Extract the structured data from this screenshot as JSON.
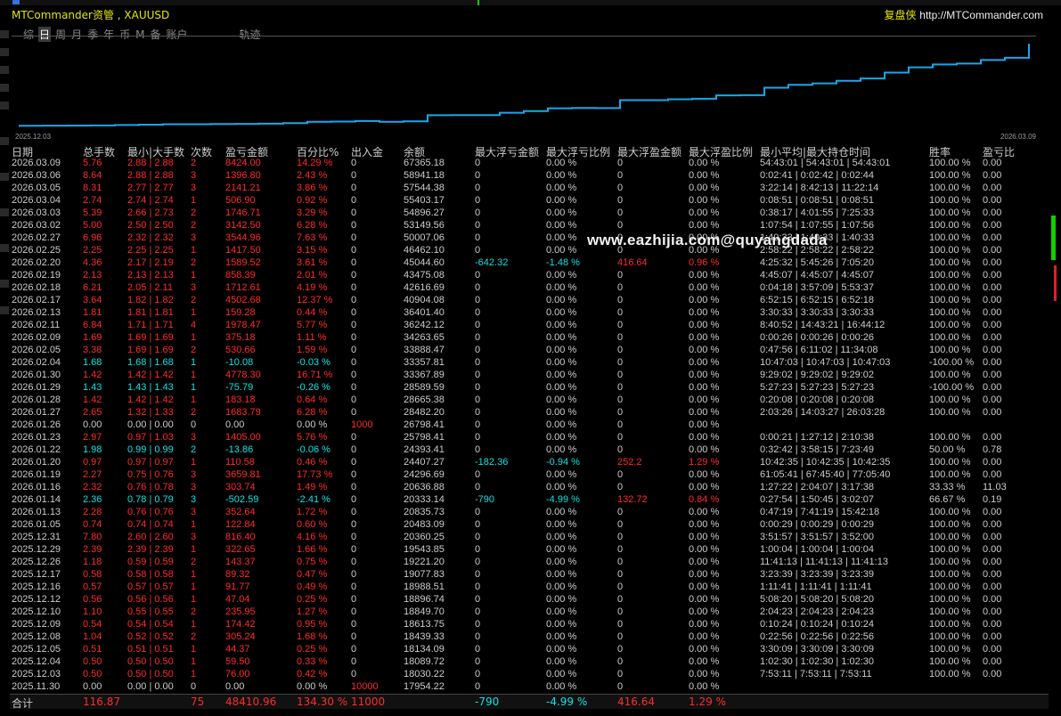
{
  "window": {
    "title": "MTCommander资管 , XAUUSD",
    "brand_cn": "复盘侠",
    "brand_url": "http://MTCommander.com"
  },
  "tabs": [
    {
      "label": "综",
      "active": false
    },
    {
      "label": "日",
      "active": true
    },
    {
      "label": "周",
      "active": false
    },
    {
      "label": "月",
      "active": false
    },
    {
      "label": "季",
      "active": false
    },
    {
      "label": "年",
      "active": false
    },
    {
      "label": "币",
      "active": false
    },
    {
      "label": "M",
      "active": false
    },
    {
      "label": "备",
      "active": false
    },
    {
      "label": "账户",
      "active": false
    },
    {
      "label": "轨迹",
      "active": false
    }
  ],
  "chart": {
    "start_label": "2025.12.03",
    "end_label": "2026.03.09",
    "line_color": "#1aa7ec"
  },
  "chart_data": {
    "type": "line",
    "x": [
      "2025.11.30",
      "2025.12.03",
      "2025.12.04",
      "2025.12.05",
      "2025.12.08",
      "2025.12.09",
      "2025.12.10",
      "2025.12.12",
      "2025.12.16",
      "2025.12.17",
      "2025.12.26",
      "2025.12.29",
      "2025.12.31",
      "2026.01.05",
      "2026.01.13",
      "2026.01.14",
      "2026.01.16",
      "2026.01.19",
      "2026.01.20",
      "2026.01.22",
      "2026.01.23",
      "2026.01.26",
      "2026.01.27",
      "2026.01.28",
      "2026.01.29",
      "2026.01.30",
      "2026.02.04",
      "2026.02.05",
      "2026.02.09",
      "2026.02.11",
      "2026.02.13",
      "2026.02.17",
      "2026.02.18",
      "2026.02.19",
      "2026.02.20",
      "2026.02.25",
      "2026.02.27",
      "2026.03.02",
      "2026.03.03",
      "2026.03.04",
      "2026.03.05",
      "2026.03.06",
      "2026.03.09"
    ],
    "series": [
      {
        "values": [
          17954.22,
          18030.22,
          18089.72,
          18134.09,
          18439.33,
          18613.75,
          18849.7,
          18896.74,
          18988.51,
          19077.83,
          19221.2,
          19543.85,
          20360.25,
          20483.09,
          20835.73,
          20333.14,
          20636.88,
          24296.69,
          24407.27,
          24393.41,
          25798.41,
          26798.41,
          28482.2,
          28665.38,
          28589.59,
          33367.89,
          33357.81,
          33888.47,
          34263.65,
          36242.12,
          36401.4,
          40904.08,
          42616.69,
          43475.08,
          45044.6,
          46462.1,
          50007.06,
          53149.56,
          54896.27,
          55403.17,
          57544.38,
          58941.18,
          67365.18
        ]
      }
    ],
    "ylim": [
      17000,
      68500
    ],
    "grid": false
  },
  "columns": [
    "日期",
    "总手数",
    "最小|大手数",
    "次数",
    "盈亏金额",
    "百分比%",
    "出入金",
    "余额",
    "最大浮亏金额",
    "最大浮亏比例",
    "最大浮盈金额",
    "最大浮盈比例",
    "最小平均|最大持仓时间",
    "胜率",
    "盈亏比"
  ],
  "rows": [
    [
      "2026.03.09",
      "5.76",
      "2.88 | 2.88",
      "2",
      "8424.00",
      "14.29 %",
      "0",
      "67365.18",
      "0",
      "0.00 %",
      "0",
      "0.00 %",
      "54:43:01 | 54:43:01 | 54:43:01",
      "100.00 %",
      "0.00"
    ],
    [
      "2026.03.06",
      "8.64",
      "2.88 | 2.88",
      "3",
      "1396.80",
      "2.43 %",
      "0",
      "58941.18",
      "0",
      "0.00 %",
      "0",
      "0.00 %",
      "0:02:41 | 0:02:42 | 0:02:44",
      "100.00 %",
      "0.00"
    ],
    [
      "2026.03.05",
      "8.31",
      "2.77 | 2.77",
      "3",
      "2141.21",
      "3.86 %",
      "0",
      "57544.38",
      "0",
      "0.00 %",
      "0",
      "0.00 %",
      "3:22:14 | 8:42:13 | 11:22:14",
      "100.00 %",
      "0.00"
    ],
    [
      "2026.03.04",
      "2.74",
      "2.74 | 2.74",
      "1",
      "506.90",
      "0.92 %",
      "0",
      "55403.17",
      "0",
      "0.00 %",
      "0",
      "0.00 %",
      "0:08:51 | 0:08:51 | 0:08:51",
      "100.00 %",
      "0.00"
    ],
    [
      "2026.03.03",
      "5.39",
      "2.66 | 2.73",
      "2",
      "1746.71",
      "3.29 %",
      "0",
      "54896.27",
      "0",
      "0.00 %",
      "0",
      "0.00 %",
      "0:38:17 | 4:01:55 | 7:25:33",
      "100.00 %",
      "0.00"
    ],
    [
      "2026.03.02",
      "5.00",
      "2.50 | 2.50",
      "2",
      "3142.50",
      "6.28 %",
      "0",
      "53149.56",
      "0",
      "0.00 %",
      "0",
      "0.00 %",
      "1:07:54 | 1:07:55 | 1:07:56",
      "100.00 %",
      "0.00"
    ],
    [
      "2026.02.27",
      "6.96",
      "2.32 | 2.32",
      "3",
      "3544.96",
      "7.63 %",
      "0",
      "50007.06",
      "0",
      "0.00 %",
      "0",
      "0.00 %",
      "1:40:33 | 1:40:33 | 1:40:33",
      "100.00 %",
      "0.00"
    ],
    [
      "2026.02.25",
      "2.25",
      "2.25 | 2.25",
      "1",
      "1417.50",
      "3.15 %",
      "0",
      "46462.10",
      "0",
      "0.00 %",
      "0",
      "0.00 %",
      "2:58:22 | 2:58:22 | 2:58:22",
      "100.00 %",
      "0.00"
    ],
    [
      "2026.02.20",
      "4.36",
      "2.17 | 2.19",
      "2",
      "1589.52",
      "3.61 %",
      "0",
      "45044.60",
      "-642.32",
      "-1.48 %",
      "416.64",
      "0.96 %",
      "4:25:32 | 5:45:26 | 7:05:20",
      "100.00 %",
      "0.00"
    ],
    [
      "2026.02.19",
      "2.13",
      "2.13 | 2.13",
      "1",
      "858.39",
      "2.01 %",
      "0",
      "43475.08",
      "0",
      "0.00 %",
      "0",
      "0.00 %",
      "4:45:07 | 4:45:07 | 4:45:07",
      "100.00 %",
      "0.00"
    ],
    [
      "2026.02.18",
      "6.21",
      "2.05 | 2.11",
      "3",
      "1712.61",
      "4.19 %",
      "0",
      "42616.69",
      "0",
      "0.00 %",
      "0",
      "0.00 %",
      "0:04:18 | 3:57:09 | 5:53:37",
      "100.00 %",
      "0.00"
    ],
    [
      "2026.02.17",
      "3.64",
      "1.82 | 1.82",
      "2",
      "4502.68",
      "12.37 %",
      "0",
      "40904.08",
      "0",
      "0.00 %",
      "0",
      "0.00 %",
      "6:52:15 | 6:52:15 | 6:52:18",
      "100.00 %",
      "0.00"
    ],
    [
      "2026.02.13",
      "1.81",
      "1.81 | 1.81",
      "1",
      "159.28",
      "0.44 %",
      "0",
      "36401.40",
      "0",
      "0.00 %",
      "0",
      "0.00 %",
      "3:30:33 | 3:30:33 | 3:30:33",
      "100.00 %",
      "0.00"
    ],
    [
      "2026.02.11",
      "6.84",
      "1.71 | 1.71",
      "4",
      "1978.47",
      "5.77 %",
      "0",
      "36242.12",
      "0",
      "0.00 %",
      "0",
      "0.00 %",
      "8:40:52 | 14:43:21 | 16:44:12",
      "100.00 %",
      "0.00"
    ],
    [
      "2026.02.09",
      "1.69",
      "1.69 | 1.69",
      "1",
      "375.18",
      "1.11 %",
      "0",
      "34263.65",
      "0",
      "0.00 %",
      "0",
      "0.00 %",
      "0:00:26 | 0:00:26 | 0:00:26",
      "100.00 %",
      "0.00"
    ],
    [
      "2026.02.05",
      "3.38",
      "1.69 | 1.69",
      "2",
      "530.66",
      "1.59 %",
      "0",
      "33888.47",
      "0",
      "0.00 %",
      "0",
      "0.00 %",
      "0:47:56 | 6:11:02 | 11:34:08",
      "100.00 %",
      "0.00"
    ],
    [
      "2026.02.04",
      "1.68",
      "1.68 | 1.68",
      "1",
      "-10.08",
      "-0.03 %",
      "0",
      "33357.81",
      "0",
      "0.00 %",
      "0",
      "0.00 %",
      "10:47:03 | 10:47:03 | 10:47:03",
      "-100.00 %",
      "0.00"
    ],
    [
      "2026.01.30",
      "1.42",
      "1.42 | 1.42",
      "1",
      "4778.30",
      "16.71 %",
      "0",
      "33367.89",
      "0",
      "0.00 %",
      "0",
      "0.00 %",
      "9:29:02 | 9:29:02 | 9:29:02",
      "100.00 %",
      "0.00"
    ],
    [
      "2026.01.29",
      "1.43",
      "1.43 | 1.43",
      "1",
      "-75.79",
      "-0.26 %",
      "0",
      "28589.59",
      "0",
      "0.00 %",
      "0",
      "0.00 %",
      "5:27:23 | 5:27:23 | 5:27:23",
      "-100.00 %",
      "0.00"
    ],
    [
      "2026.01.28",
      "1.42",
      "1.42 | 1.42",
      "1",
      "183.18",
      "0.64 %",
      "0",
      "28665.38",
      "0",
      "0.00 %",
      "0",
      "0.00 %",
      "0:20:08 | 0:20:08 | 0:20:08",
      "100.00 %",
      "0.00"
    ],
    [
      "2026.01.27",
      "2.65",
      "1.32 | 1.33",
      "2",
      "1683.79",
      "6.28 %",
      "0",
      "28482.20",
      "0",
      "0.00 %",
      "0",
      "0.00 %",
      "2:03:26 | 14:03:27 | 26:03:28",
      "100.00 %",
      "0.00"
    ],
    [
      "2026.01.26",
      "0.00",
      "0.00 | 0.00",
      "0",
      "0.00",
      "0.00 %",
      "1000",
      "26798.41",
      "0",
      "0.00 %",
      "0",
      "0.00 %",
      "",
      "",
      ""
    ],
    [
      "2026.01.23",
      "2.97",
      "0.97 | 1.03",
      "3",
      "1405.00",
      "5.76 %",
      "0",
      "25798.41",
      "0",
      "0.00 %",
      "0",
      "0.00 %",
      "0:00:21 | 1:27:12 | 2:10:38",
      "100.00 %",
      "0.00"
    ],
    [
      "2026.01.22",
      "1.98",
      "0.99 | 0.99",
      "2",
      "-13.86",
      "-0.06 %",
      "0",
      "24393.41",
      "0",
      "0.00 %",
      "0",
      "0.00 %",
      "0:32:42 | 3:58:15 | 7:23:49",
      "50.00 %",
      "0.78"
    ],
    [
      "2026.01.20",
      "0.97",
      "0.97 | 0.97",
      "1",
      "110.58",
      "0.46 %",
      "0",
      "24407.27",
      "-182.36",
      "-0.94 %",
      "252.2",
      "1.29 %",
      "10:42:35 | 10:42:35 | 10:42:35",
      "100.00 %",
      "0.00"
    ],
    [
      "2026.01.19",
      "2.27",
      "0.75 | 0.76",
      "3",
      "3659.81",
      "17.73 %",
      "0",
      "24296.69",
      "0",
      "0.00 %",
      "0",
      "0.00 %",
      "61:05:41 | 67:45:40 | 77:05:40",
      "100.00 %",
      "0.00"
    ],
    [
      "2026.01.16",
      "2.32",
      "0.76 | 0.78",
      "3",
      "303.74",
      "1.49 %",
      "0",
      "20636.88",
      "0",
      "0.00 %",
      "0",
      "0.00 %",
      "1:27:22 | 2:04:07 | 3:17:38",
      "33.33 %",
      "11.03"
    ],
    [
      "2026.01.14",
      "2.36",
      "0.78 | 0.79",
      "3",
      "-502.59",
      "-2.41 %",
      "0",
      "20333.14",
      "-790",
      "-4.99 %",
      "132.72",
      "0.84 %",
      "0:27:54 | 1:50:45 | 3:02:07",
      "66.67 %",
      "0.19"
    ],
    [
      "2026.01.13",
      "2.28",
      "0.76 | 0.76",
      "3",
      "352.64",
      "1.72 %",
      "0",
      "20835.73",
      "0",
      "0.00 %",
      "0",
      "0.00 %",
      "0:47:19 | 7:41:19 | 15:42:18",
      "100.00 %",
      "0.00"
    ],
    [
      "2026.01.05",
      "0.74",
      "0.74 | 0.74",
      "1",
      "122.84",
      "0.60 %",
      "0",
      "20483.09",
      "0",
      "0.00 %",
      "0",
      "0.00 %",
      "0:00:29 | 0:00:29 | 0:00:29",
      "100.00 %",
      "0.00"
    ],
    [
      "2025.12.31",
      "7.80",
      "2.60 | 2.60",
      "3",
      "816.40",
      "4.16 %",
      "0",
      "20360.25",
      "0",
      "0.00 %",
      "0",
      "0.00 %",
      "3:51:57 | 3:51:57 | 3:52:00",
      "100.00 %",
      "0.00"
    ],
    [
      "2025.12.29",
      "2.39",
      "2.39 | 2.39",
      "1",
      "322.65",
      "1.66 %",
      "0",
      "19543.85",
      "0",
      "0.00 %",
      "0",
      "0.00 %",
      "1:00:04 | 1:00:04 | 1:00:04",
      "100.00 %",
      "0.00"
    ],
    [
      "2025.12.26",
      "1.18",
      "0.59 | 0.59",
      "2",
      "143.37",
      "0.75 %",
      "0",
      "19221.20",
      "0",
      "0.00 %",
      "0",
      "0.00 %",
      "11:41:13 | 11:41:13 | 11:41:13",
      "100.00 %",
      "0.00"
    ],
    [
      "2025.12.17",
      "0.58",
      "0.58 | 0.58",
      "1",
      "89.32",
      "0.47 %",
      "0",
      "19077.83",
      "0",
      "0.00 %",
      "0",
      "0.00 %",
      "3:23:39 | 3:23:39 | 3:23:39",
      "100.00 %",
      "0.00"
    ],
    [
      "2025.12.16",
      "0.57",
      "0.57 | 0.57",
      "1",
      "91.77",
      "0.49 %",
      "0",
      "18988.51",
      "0",
      "0.00 %",
      "0",
      "0.00 %",
      "1:11:41 | 1:11:41 | 1:11:41",
      "100.00 %",
      "0.00"
    ],
    [
      "2025.12.12",
      "0.56",
      "0.56 | 0.56",
      "1",
      "47.04",
      "0.25 %",
      "0",
      "18896.74",
      "0",
      "0.00 %",
      "0",
      "0.00 %",
      "5:08:20 | 5:08:20 | 5:08:20",
      "100.00 %",
      "0.00"
    ],
    [
      "2025.12.10",
      "1.10",
      "0.55 | 0.55",
      "2",
      "235.95",
      "1.27 %",
      "0",
      "18849.70",
      "0",
      "0.00 %",
      "0",
      "0.00 %",
      "2:04:23 | 2:04:23 | 2:04:23",
      "100.00 %",
      "0.00"
    ],
    [
      "2025.12.09",
      "0.54",
      "0.54 | 0.54",
      "1",
      "174.42",
      "0.95 %",
      "0",
      "18613.75",
      "0",
      "0.00 %",
      "0",
      "0.00 %",
      "0:10:24 | 0:10:24 | 0:10:24",
      "100.00 %",
      "0.00"
    ],
    [
      "2025.12.08",
      "1.04",
      "0.52 | 0.52",
      "2",
      "305.24",
      "1.68 %",
      "0",
      "18439.33",
      "0",
      "0.00 %",
      "0",
      "0.00 %",
      "0:22:56 | 0:22:56 | 0:22:56",
      "100.00 %",
      "0.00"
    ],
    [
      "2025.12.05",
      "0.51",
      "0.51 | 0.51",
      "1",
      "44.37",
      "0.25 %",
      "0",
      "18134.09",
      "0",
      "0.00 %",
      "0",
      "0.00 %",
      "3:30:09 | 3:30:09 | 3:30:09",
      "100.00 %",
      "0.00"
    ],
    [
      "2025.12.04",
      "0.50",
      "0.50 | 0.50",
      "1",
      "59.50",
      "0.33 %",
      "0",
      "18089.72",
      "0",
      "0.00 %",
      "0",
      "0.00 %",
      "1:02:30 | 1:02:30 | 1:02:30",
      "100.00 %",
      "0.00"
    ],
    [
      "2025.12.03",
      "0.50",
      "0.50 | 0.50",
      "1",
      "76.00",
      "0.42 %",
      "0",
      "18030.22",
      "0",
      "0.00 %",
      "0",
      "0.00 %",
      "7:53:11 | 7:53:11 | 7:53:11",
      "100.00 %",
      "0.00"
    ],
    [
      "2025.11.30",
      "0.00",
      "0.00 | 0.00",
      "0",
      "0.00",
      "0.00 %",
      "10000",
      "17954.22",
      "0",
      "0.00 %",
      "0",
      "0.00 %",
      "",
      "",
      ""
    ]
  ],
  "totals": {
    "label": "合计",
    "total_lots": "116.87",
    "count": "75",
    "pnl": "48410.96",
    "pct": "134.30 %",
    "deposit": "11000",
    "max_float_loss": "-790",
    "max_float_loss_pct": "-4.99 %",
    "max_float_profit": "416.64",
    "max_float_profit_pct": "1.29 %"
  },
  "watermark": "www.eazhijia.com@quyangdada",
  "colors": {
    "negative": "#12e2e2",
    "positive": "#ff2b2b",
    "neutral": "#cccccc",
    "title": "#e6e600"
  }
}
